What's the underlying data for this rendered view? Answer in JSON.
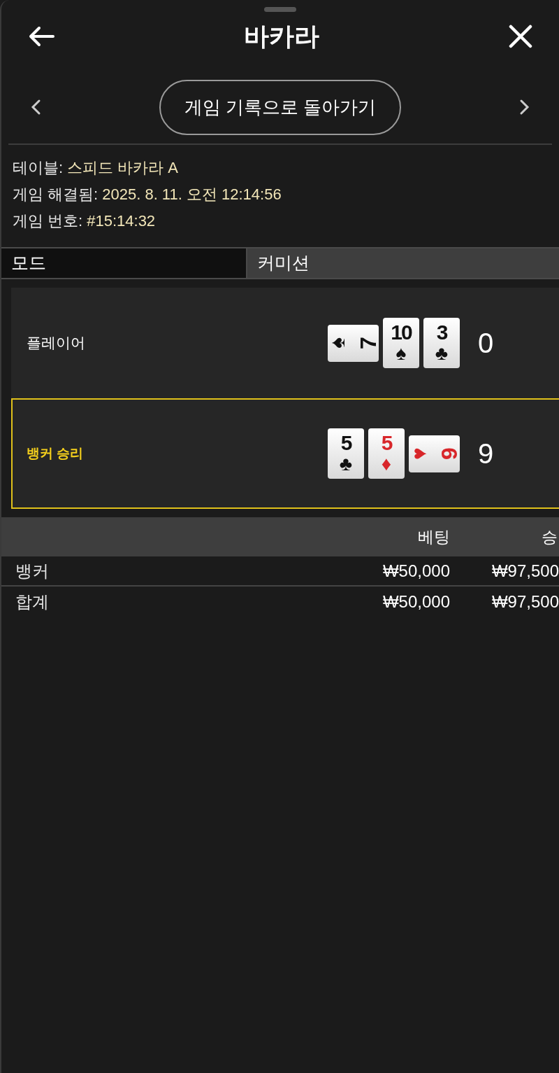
{
  "header": {
    "title": "바카라"
  },
  "nav": {
    "button": "게임 기록으로 돌아가기"
  },
  "info": [
    {
      "label": "테이블:",
      "value": "스피드 바카라 A"
    },
    {
      "label": "게임 해결됨:",
      "value": "2025. 8. 11. 오전 12:14:56"
    },
    {
      "label": "게임 번호:",
      "value": "#15:14:32"
    }
  ],
  "mode": {
    "label": "모드",
    "value": "커미션"
  },
  "hands": [
    {
      "label": "플레이어",
      "winner": false,
      "score": "0",
      "cards": [
        {
          "rank": "7",
          "suit": "♠",
          "color": "#111111",
          "sideways": true
        },
        {
          "rank": "10",
          "suit": "♠",
          "color": "#111111",
          "sideways": false
        },
        {
          "rank": "3",
          "suit": "♣",
          "color": "#111111",
          "sideways": false
        }
      ]
    },
    {
      "label": "뱅커 승리",
      "winner": true,
      "score": "9",
      "cards": [
        {
          "rank": "5",
          "suit": "♣",
          "color": "#111111",
          "sideways": false
        },
        {
          "rank": "5",
          "suit": "♦",
          "color": "#d8262a",
          "sideways": false
        },
        {
          "rank": "9",
          "suit": "♥",
          "color": "#d8262a",
          "sideways": true
        }
      ]
    }
  ],
  "table": {
    "columns": [
      "",
      "베팅",
      "승"
    ],
    "rows": [
      {
        "cells": [
          "뱅커",
          "₩50,000",
          "₩97,500"
        ]
      },
      {
        "cells": [
          "합계",
          "₩50,000",
          "₩97,500"
        ]
      }
    ]
  }
}
